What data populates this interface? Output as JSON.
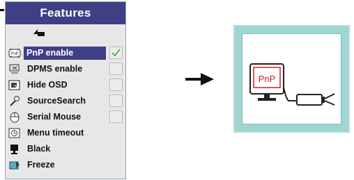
{
  "menu": {
    "title": "Features",
    "back_icon": "up-left-arrow-icon",
    "items": [
      {
        "label": "PnP enable",
        "icon": "pnp-icon",
        "selected": true,
        "checkbox": true,
        "checked": true
      },
      {
        "label": "DPMS enable",
        "icon": "dpms-icon",
        "selected": false,
        "checkbox": true,
        "checked": false
      },
      {
        "label": "Hide OSD",
        "icon": "hide-osd-icon",
        "selected": false,
        "checkbox": true,
        "checked": false
      },
      {
        "label": "SourceSearch",
        "icon": "source-search-icon",
        "selected": false,
        "checkbox": true,
        "checked": false
      },
      {
        "label": "Serial Mouse",
        "icon": "serial-mouse-icon",
        "selected": false,
        "checkbox": true,
        "checked": false
      },
      {
        "label": "Menu timeout",
        "icon": "menu-timeout-icon",
        "selected": false,
        "checkbox": false
      },
      {
        "label": "Black",
        "icon": "black-icon",
        "selected": false,
        "checkbox": false
      },
      {
        "label": "Freeze",
        "icon": "freeze-icon",
        "selected": false,
        "checkbox": false
      }
    ]
  },
  "illustration": {
    "monitor_label": "PnP",
    "colors": {
      "menu_title_bg": "#3f3f86",
      "panel_bg": "#9fd6d3",
      "pnp_red": "#cc2222",
      "check_green": "#22aa22"
    }
  }
}
